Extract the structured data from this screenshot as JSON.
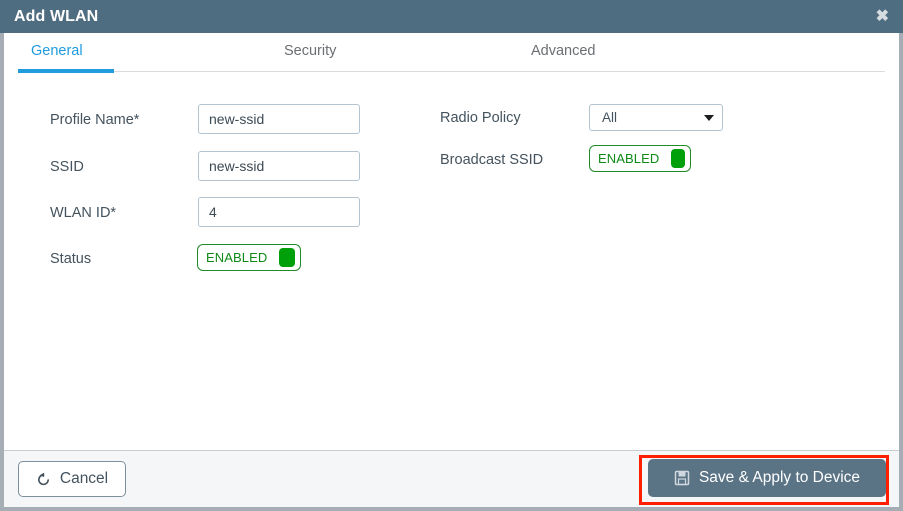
{
  "window": {
    "title": "Add WLAN",
    "close_icon": "close-icon",
    "close_glyph": "✖"
  },
  "tabs": [
    {
      "label": "General",
      "active": true
    },
    {
      "label": "Security",
      "active": false
    },
    {
      "label": "Advanced",
      "active": false
    }
  ],
  "form": {
    "left_column": [
      {
        "label": "Profile Name*",
        "type": "text",
        "value": "new-ssid",
        "placeholder": ""
      },
      {
        "label": "SSID",
        "type": "text",
        "value": "new-ssid",
        "placeholder": ""
      },
      {
        "label": "WLAN ID*",
        "type": "text",
        "value": "4",
        "placeholder": ""
      },
      {
        "label": "Status",
        "type": "toggle",
        "value": "ENABLED"
      }
    ],
    "right_column": [
      {
        "label": "Radio Policy",
        "type": "select",
        "value": "All"
      },
      {
        "label": "Broadcast SSID",
        "type": "toggle",
        "value": "ENABLED"
      }
    ]
  },
  "footer": {
    "cancel_label": "Cancel",
    "cancel_icon": "undo-icon",
    "cancel_glyph": "↺",
    "save_label": "Save & Apply to Device",
    "save_icon": "floppy-disk-icon"
  },
  "colors": {
    "titlebar": "#4f6d80",
    "accent_blue": "#1f9bde",
    "toggle_green": "#00a00a",
    "toggle_border_green": "#1f8a28",
    "save_button": "#5a7385",
    "highlight_red": "#ff1e00",
    "footer_bg": "#f5f6f7",
    "modal_border": "#a7adb4"
  }
}
